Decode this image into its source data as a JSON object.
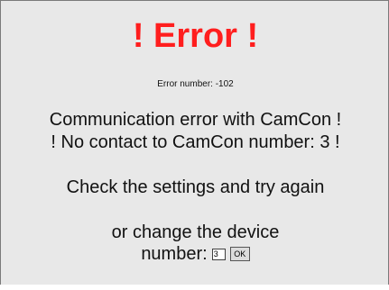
{
  "colors": {
    "title": "#ff1e1e",
    "background": "#e8e8e8",
    "text": "#111111"
  },
  "error": {
    "title": "! Error !",
    "number_text": "Error number: -102",
    "message_line_1": "Communication error with CamCon !",
    "message_line_2": "! No contact to CamCon number: 3 !",
    "instruction": "Check the settings and try again",
    "change_line": "or change the device",
    "number_label": "number:",
    "device_number_value": "3",
    "ok_label": "OK"
  }
}
